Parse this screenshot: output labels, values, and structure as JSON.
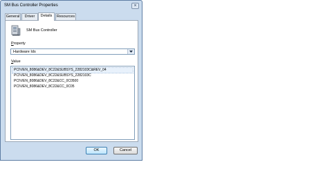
{
  "window": {
    "title": "SM Bus Controller Properties",
    "close_label": "×"
  },
  "tabs": [
    {
      "label": "General"
    },
    {
      "label": "Driver"
    },
    {
      "label": "Details"
    },
    {
      "label": "Resources"
    }
  ],
  "active_tab": "Details",
  "device": {
    "name": "SM Bus Controller",
    "icon": "device-icon"
  },
  "property": {
    "label_underlined": "P",
    "label_rest": "roperty",
    "selected": "Hardware Ids"
  },
  "value": {
    "label_underlined": "V",
    "label_rest": "alue",
    "items": [
      "PCI\\VEN_8086&DEV_8C22&SUBSYS_2282103C&REV_04",
      "PCI\\VEN_8086&DEV_8C22&SUBSYS_2282103C",
      "PCI\\VEN_8086&DEV_8C22&CC_0C0500",
      "PCI\\VEN_8086&DEV_8C22&CC_0C05"
    ],
    "selected_index": 0
  },
  "buttons": {
    "ok": "OK",
    "cancel": "Cancel"
  }
}
